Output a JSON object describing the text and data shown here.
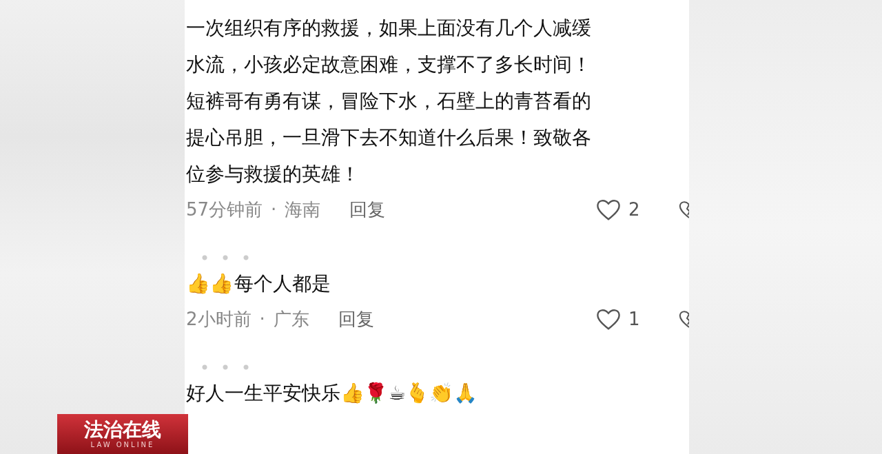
{
  "comments": [
    {
      "lines": [
        "一次组织有序的救援，如果上面没有几个人减缓",
        "水流，小孩必定故意困难，支撑不了多长时间！",
        "短裤哥有勇有谋，冒险下水，石壁上的青苔看的",
        "提心吊胆，一旦滑下去不知道什么后果！致敬各",
        "位参与救援的英雄！"
      ],
      "time": "57分钟前",
      "separator": "·",
      "region": "海南",
      "reply": "回复",
      "likes": "2"
    },
    {
      "lines": [
        "👍👍每个人都是"
      ],
      "time": "2小时前",
      "separator": "·",
      "region": "广东",
      "reply": "回复",
      "likes": "1"
    },
    {
      "lines": [
        "好人一生平安快乐👍🌹☕🫰👏🙏"
      ]
    }
  ],
  "program_badge": {
    "title": "法治在线",
    "subtitle": "LAW ONLINE"
  }
}
